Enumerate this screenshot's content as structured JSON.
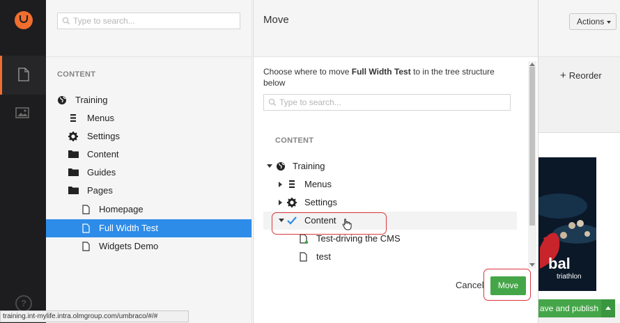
{
  "tree": {
    "search_placeholder": "Type to search...",
    "section_title": "CONTENT",
    "items": [
      {
        "label": "Training",
        "icon": "globe-icon"
      },
      {
        "label": "Menus",
        "icon": "list-icon"
      },
      {
        "label": "Settings",
        "icon": "gear-icon"
      },
      {
        "label": "Content",
        "icon": "folder-icon"
      },
      {
        "label": "Guides",
        "icon": "folder-icon"
      },
      {
        "label": "Pages",
        "icon": "folder-icon"
      },
      {
        "label": "Homepage",
        "icon": "document-icon"
      },
      {
        "label": "Full Width Test",
        "icon": "document-icon",
        "selected": true
      },
      {
        "label": "Widgets Demo",
        "icon": "document-icon"
      }
    ]
  },
  "dialog": {
    "title": "Move",
    "desc_prefix": "Choose where to move ",
    "desc_item": "Full Width Test",
    "desc_suffix": " to in the tree structure below",
    "search_placeholder": "Type to search...",
    "section_title": "CONTENT",
    "items": [
      {
        "label": "Training",
        "icon": "globe-icon",
        "expanded": true
      },
      {
        "label": "Menus",
        "icon": "list-icon",
        "expanded": false
      },
      {
        "label": "Settings",
        "icon": "gear-icon",
        "expanded": false
      },
      {
        "label": "Content",
        "icon": "checkmark-icon",
        "expanded": true,
        "selected": true
      },
      {
        "label": "Test-driving the CMS",
        "icon": "document-icon"
      },
      {
        "label": "test",
        "icon": "document-icon"
      }
    ],
    "cancel_label": "Cancel",
    "move_label": "Move"
  },
  "content": {
    "actions_label": "Actions",
    "reorder_label": "Reorder",
    "save_publish_label": "ave and publish",
    "preview_logo_text": "bal",
    "preview_logo_sub": "triathlon"
  },
  "status_bar": {
    "url": "training.int-mylife.intra.olmgroup.com/umbraco/#/#"
  },
  "colors": {
    "sidebar_bg": "#1d1d1f",
    "brand_orange": "#f06e2e",
    "selected_blue": "#2d8ce8",
    "green_button": "#44a648",
    "highlight_red": "#d9363e"
  }
}
